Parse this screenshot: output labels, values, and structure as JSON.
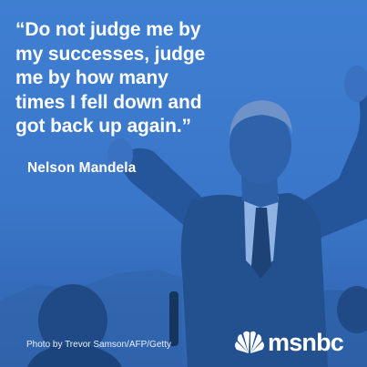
{
  "quote": {
    "lines": [
      "“Do not judge me by",
      "my successes, judge",
      "me by how many",
      "times I fell down and",
      "got back up again.”"
    ]
  },
  "author": "Nelson Mandela",
  "credit": "Photo by Trevor Samson/AFP/Getty",
  "brand": {
    "name": "msnbc",
    "icon": "peacock-logo-icon"
  },
  "colors": {
    "background": "#3a78cc",
    "text": "#ffffff"
  }
}
